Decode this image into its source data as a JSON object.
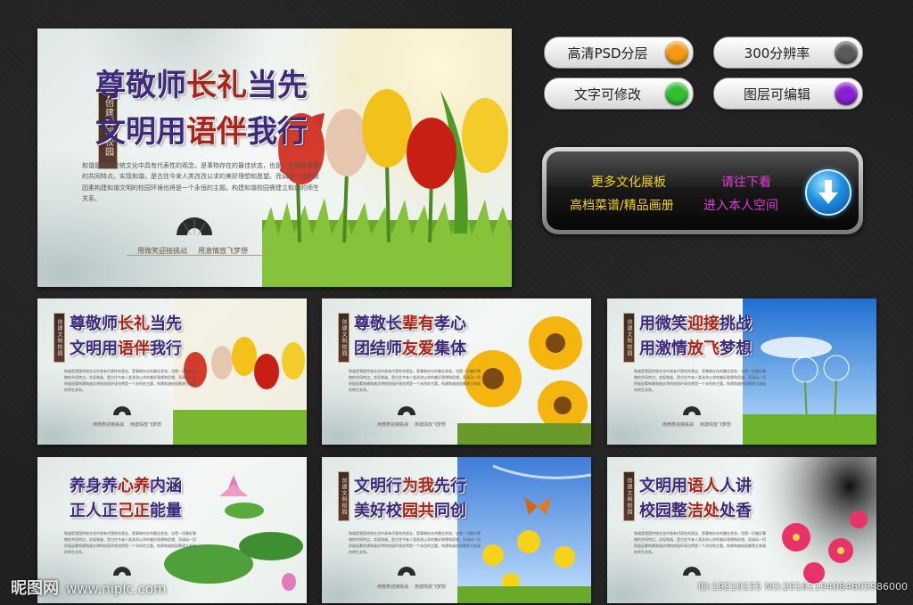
{
  "features": [
    {
      "label": "高清PSD分层",
      "color": "#f59a12"
    },
    {
      "label": "300分辨率",
      "color": "#5a5a5a"
    },
    {
      "label": "文字可修改",
      "color": "#2fbf2f"
    },
    {
      "label": "图层可编辑",
      "color": "#8a1fd0"
    }
  ],
  "promo": {
    "line1": "更多文化展板",
    "line2": "高档菜谱/精品画册",
    "line3": "请往下看",
    "line4": "进入本人空间"
  },
  "seal_text": "创建文明校园",
  "body_text": "和谐是我国传统文化中具有代表性的观念，是事物存在的最佳状态，也是一切美好事物的共同特点。实现和谐，是古往今来人类孜孜以求的美好理想和愿望。而调动一切积极因素构建和谐文明的校园环境也将是一个永恒的主题。构建和谐校园需建立和谐的师生关系。",
  "footer": {
    "left": "用微笑迎接挑战",
    "right": "用激情放飞梦想"
  },
  "main_board": {
    "title1": "尊敬师长礼当先",
    "title2": "文明用语伴我行"
  },
  "boards": [
    {
      "title1": "尊敬师长礼当先",
      "title2": "文明用语伴我行"
    },
    {
      "title1": "尊敬长辈有孝心",
      "title2": "团结师友爱集体"
    },
    {
      "title1": "用微笑迎接挑战",
      "title2": "用激情放飞梦想"
    },
    {
      "title1": "养身养心养内涵",
      "title2": "正人正己正能量"
    },
    {
      "title1": "文明行为我先行",
      "title2": "美好校园共同创"
    },
    {
      "title1": "文明用语人人讲",
      "title2": "校园整洁处处香"
    }
  ],
  "watermark": {
    "brand": "昵图网",
    "url": "www.nipic.com"
  },
  "image_id": "ID:19210155 NO:20161104084605986000"
}
